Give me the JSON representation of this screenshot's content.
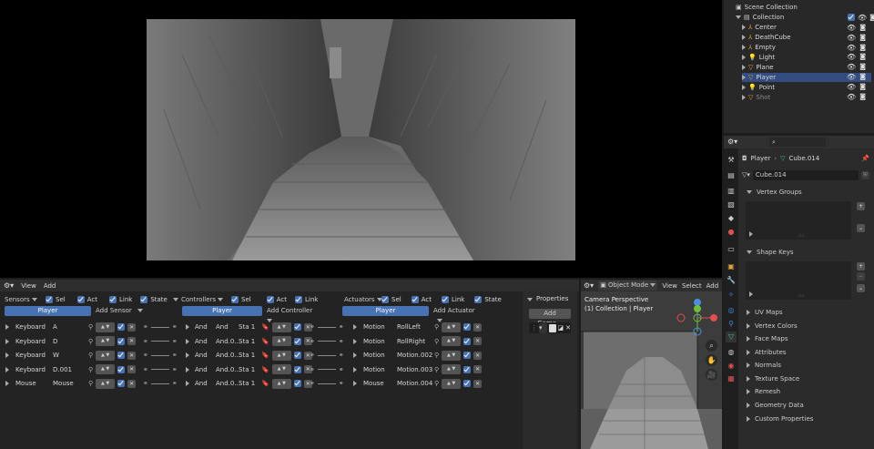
{
  "viewport_game": {
    "description_colors": {
      "bg": "#000000",
      "render_bg": "#6a6a6a"
    }
  },
  "outliner": {
    "scene_label": "Scene Collection",
    "collection_label": "Collection",
    "items": [
      {
        "label": "Center",
        "icon": "empty-icon",
        "color": "#e5a43a"
      },
      {
        "label": "DeathCube",
        "icon": "empty-icon",
        "color": "#e5a43a"
      },
      {
        "label": "Empty",
        "icon": "empty-icon",
        "color": "#e5a43a"
      },
      {
        "label": "Light",
        "icon": "light-icon",
        "color": "#e5a43a"
      },
      {
        "label": "Plane",
        "icon": "mesh-icon",
        "color": "#e5a43a"
      },
      {
        "label": "Player",
        "icon": "mesh-icon",
        "color": "#e5a43a",
        "selected": true
      },
      {
        "label": "Point",
        "icon": "light-icon",
        "color": "#e5a43a"
      },
      {
        "label": "Shot",
        "icon": "mesh-icon",
        "color": "#e5a43a"
      }
    ]
  },
  "properties": {
    "search_placeholder": "",
    "breadcrumb_object": "Player",
    "breadcrumb_mesh": "Cube.014",
    "mesh_name": "Cube.014",
    "panels": {
      "vertex_groups": "Vertex Groups",
      "shape_keys": "Shape Keys",
      "uv_maps": "UV Maps",
      "vertex_colors": "Vertex Colors",
      "face_maps": "Face Maps",
      "attributes": "Attributes",
      "normals": "Normals",
      "texture_space": "Texture Space",
      "remesh": "Remesh",
      "geometry_data": "Geometry Data",
      "custom_properties": "Custom Properties"
    }
  },
  "logic_editor": {
    "menu_view": "View",
    "menu_add": "Add",
    "sensors_label": "Sensors",
    "controllers_label": "Controllers",
    "actuators_label": "Actuators",
    "sel": "Sel",
    "act": "Act",
    "link": "Link",
    "state": "State",
    "object_name": "Player",
    "add_sensor": "Add Sensor",
    "add_controller": "Add Controller",
    "add_actuator": "Add Actuator",
    "sensors": [
      {
        "type": "Keyboard",
        "name": "A"
      },
      {
        "type": "Keyboard",
        "name": "D"
      },
      {
        "type": "Keyboard",
        "name": "W"
      },
      {
        "type": "Keyboard",
        "name": "D.001"
      },
      {
        "type": "Mouse",
        "name": "Mouse"
      }
    ],
    "controllers": [
      {
        "type": "And",
        "name": "And",
        "state": "Sta 1"
      },
      {
        "type": "And",
        "name": "And.0...",
        "state": "Sta 1"
      },
      {
        "type": "And",
        "name": "And.0...",
        "state": "Sta 1"
      },
      {
        "type": "And",
        "name": "And.0...",
        "state": "Sta 1"
      },
      {
        "type": "And",
        "name": "And.0...",
        "state": "Sta 1"
      }
    ],
    "actuators": [
      {
        "type": "Motion",
        "name": "RollLeft"
      },
      {
        "type": "Motion",
        "name": "RollRight"
      },
      {
        "type": "Motion",
        "name": "Motion.002"
      },
      {
        "type": "Motion",
        "name": "Motion.003"
      },
      {
        "type": "Mouse",
        "name": "Motion.004"
      }
    ],
    "properties_label": "Properties",
    "add_game_label": "Add Game..."
  },
  "viewport3d": {
    "mode": "Object Mode",
    "menu_view": "View",
    "menu_select": "Select",
    "menu_add": "Add",
    "camera_label": "Camera Perspective",
    "collection_label": "(1) Collection | Player"
  }
}
